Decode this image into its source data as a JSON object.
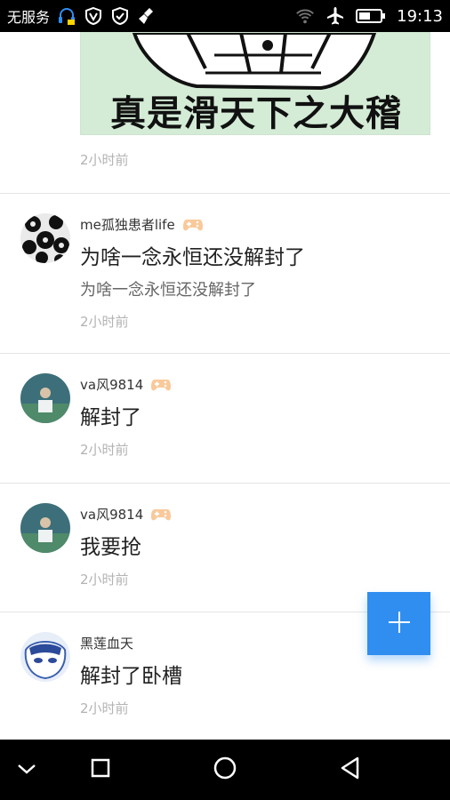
{
  "status_bar": {
    "carrier": "无服务",
    "time": "19:13"
  },
  "top_post": {
    "image_caption": "真是滑天下之大稽",
    "time": "2小时前"
  },
  "comments": [
    {
      "username": "me孤独患者life",
      "text": "为啥一念永恒还没解封了",
      "quote": "为啥一念永恒还没解封了",
      "time": "2小时前"
    },
    {
      "username": "va风9814",
      "text": "解封了",
      "time": "2小时前"
    },
    {
      "username": "va风9814",
      "text": "我要抢",
      "time": "2小时前"
    },
    {
      "username": "黑莲血天",
      "text": "解封了卧槽",
      "time": "2小时前"
    }
  ],
  "icons": {
    "fab": "plus-icon",
    "nav": [
      "chevron-down-icon",
      "square-recents-icon",
      "circle-home-icon",
      "triangle-back-icon"
    ]
  },
  "colors": {
    "accent": "#2f8ef0",
    "timestamp": "#b3b3b3"
  }
}
